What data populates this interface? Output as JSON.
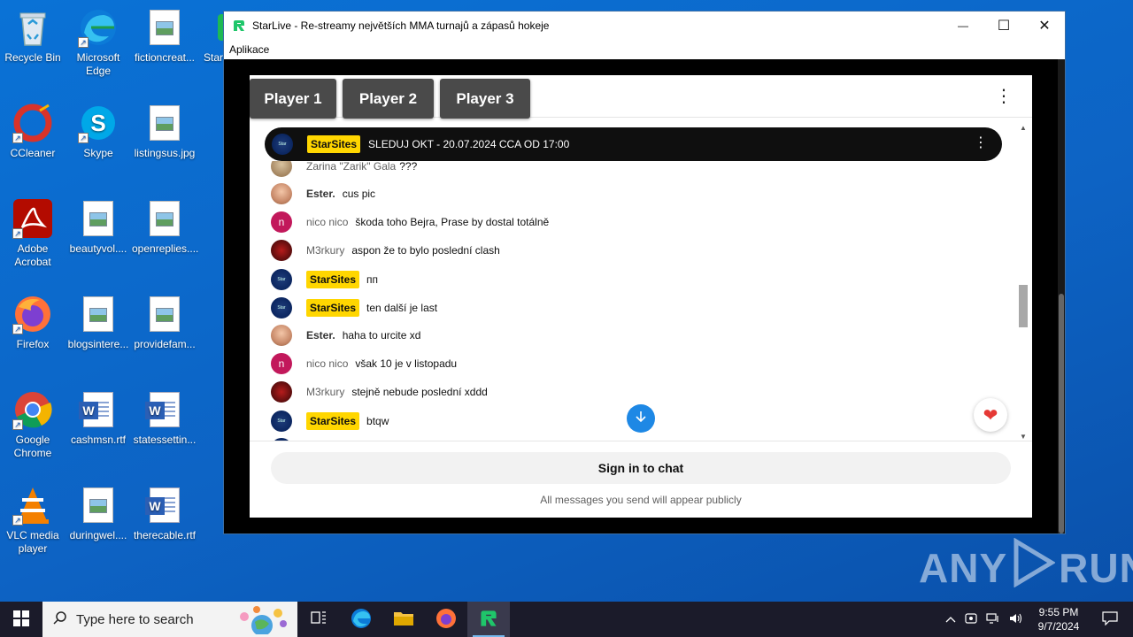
{
  "desktop": {
    "icons": [
      {
        "label": "Recycle Bin",
        "name": "recycle-bin-icon"
      },
      {
        "label": "Microsoft Edge",
        "name": "edge-icon"
      },
      {
        "label": "fictioncreat...",
        "name": "image-file-icon"
      },
      {
        "label": "Star",
        "name": "starlive-icon"
      },
      {
        "label": "CCleaner",
        "name": "ccleaner-icon"
      },
      {
        "label": "Skype",
        "name": "skype-icon"
      },
      {
        "label": "listingsus.jpg",
        "name": "image-file-icon"
      },
      {
        "label": "Adobe Acrobat",
        "name": "acrobat-icon"
      },
      {
        "label": "beautyvol....",
        "name": "image-file-icon"
      },
      {
        "label": "openreplies....",
        "name": "image-file-icon"
      },
      {
        "label": "Firefox",
        "name": "firefox-icon"
      },
      {
        "label": "blogsintere...",
        "name": "image-file-icon"
      },
      {
        "label": "providefam...",
        "name": "image-file-icon"
      },
      {
        "label": "Google Chrome",
        "name": "chrome-icon"
      },
      {
        "label": "cashmsn.rtf",
        "name": "word-file-icon"
      },
      {
        "label": "statessettin...",
        "name": "word-file-icon"
      },
      {
        "label": "VLC media player",
        "name": "vlc-icon"
      },
      {
        "label": "duringwel....",
        "name": "image-file-icon"
      },
      {
        "label": "therecable.rtf",
        "name": "word-file-icon"
      }
    ]
  },
  "window": {
    "title": "StarLive - Re-streamy největších MMA turnajů a zápasů hokeje",
    "menu": "Aplikace",
    "minimize": "—",
    "maximize": "☐",
    "close": "✕"
  },
  "players": [
    "Player 1",
    "Player 2",
    "Player 3"
  ],
  "chat": {
    "pinned": {
      "author": "StarSites",
      "text": "SLEDUJ OKT - 20.07.2024 CCA OD 17:00"
    },
    "messages": [
      {
        "author": "Zarina \"Zarik\" Gala",
        "text": "???",
        "type": "zarina"
      },
      {
        "author": "Ester.",
        "text": "cus pic",
        "type": "ester"
      },
      {
        "author": "nico nico",
        "text": "škoda toho Bejra, Prase by dostal totálně",
        "type": "nico"
      },
      {
        "author": "M3rkury",
        "text": "aspon že to bylo poslední clash",
        "type": "m3"
      },
      {
        "author": "StarSites",
        "text": "пп",
        "type": "star"
      },
      {
        "author": "StarSites",
        "text": "ten další je last",
        "type": "star"
      },
      {
        "author": "Ester.",
        "text": "haha to urcite xd",
        "type": "ester"
      },
      {
        "author": "nico nico",
        "text": "však 10 je v listopadu",
        "type": "nico"
      },
      {
        "author": "M3rkury",
        "text": "stejně nebude poslední xddd",
        "type": "m3"
      },
      {
        "author": "StarSites",
        "text": "btqw",
        "type": "star"
      }
    ],
    "avatar_n": "n",
    "signin": "Sign in to chat",
    "public_note": "All messages you send will appear publicly"
  },
  "taskbar": {
    "search_placeholder": "Type here to search",
    "time": "9:55 PM",
    "date": "9/7/2024"
  },
  "watermark": {
    "left": "ANY",
    "right": "RUN"
  },
  "colors": {
    "accent": "#1e88e5",
    "badge": "#ffd600",
    "desktop": "#0d63c4"
  }
}
